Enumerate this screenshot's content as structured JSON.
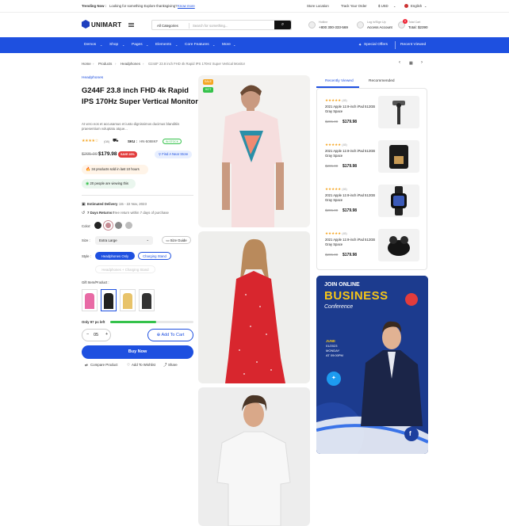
{
  "topbar": {
    "trending_prefix": "Trending Now :",
    "trending_text": "Looking for something Explore thanksgiving?",
    "trending_link": "Know more",
    "store_location": "Store Location",
    "track_order": "Track Your Order",
    "currency": "$ USD",
    "language": "English"
  },
  "header": {
    "logo": "UNIMART",
    "search_category": "All Categories",
    "search_placeholder": "Search for something...",
    "hotline_label": "Hotline",
    "hotline_number": "+800 300-333-569",
    "account_label": "Log in/Sign Up",
    "account_value": "Access Account",
    "cart_label": "Total Cart",
    "cart_total": "Total: $2390",
    "cart_count": "0"
  },
  "nav": {
    "items": [
      "Demos",
      "Shop",
      "Pages",
      "Elements",
      "Core Features",
      "More"
    ],
    "special_offers": "Special Offers",
    "recent_viewed": "Recent Viewed"
  },
  "breadcrumb": [
    "Home",
    "Products",
    "Headphones",
    "G244F 23.8 inch FHD 4k Rapid IPS 170Hz Super Vertical Monitor"
  ],
  "product": {
    "brand": "Headphones",
    "title": "G244F 23.8 inch FHD 4k Rapid IPS 170Hz Super Vertical Monitor",
    "description": "At vero eos et accusamus et iusto dignissimos ducimus blanditiis praesentium voluptatu atque...",
    "rating_count": "(08)",
    "sku_label": "SKU :",
    "sku_value": "HN-5088KF",
    "stock_badge": "IN STOCK",
    "old_price": "$295.00",
    "new_price": "$179.98",
    "discount_badge": "SAVE 20%",
    "find_store": "Find A Near Store",
    "sold_notice": "34 products sold in last 10 hours",
    "viewing_notice": "20 people are viewing this",
    "estimated_delivery_label": "Estimated Delivery :",
    "estimated_delivery_value": "15 - 22 Nov, 2023",
    "returns_label": "7 Days Returns :",
    "returns_value": "Free return within 7 days of purchase",
    "color_label": "Color:",
    "colors": [
      "#222222",
      "#c58a92",
      "#8a8a8a",
      "#bdbdbd"
    ],
    "size_label": "Size :",
    "size_value": "Extra Large",
    "size_guide": "Size Guide",
    "style_label": "Style :",
    "style_options": [
      "Headphones Only",
      "Charging Stand",
      "Headphones + Charging Stand"
    ],
    "gift_label": "Gift Item/Product :",
    "stock_left": "Only 97 pc left",
    "stock_progress": 0.55,
    "quantity": "05",
    "add_to_cart": "Add To Cart",
    "buy_now": "Buy Now",
    "compare": "Compare Product",
    "wishlist": "Add To Wishlist",
    "share": "Share"
  },
  "gallery": {
    "badge_sale": "SALE",
    "badge_hot": "HOT"
  },
  "sidebar": {
    "tabs": [
      "Recently Viewed",
      "Recommended"
    ],
    "items": [
      {
        "name": "2021 Apple 12.9-inch iPad 512GB Gray Space",
        "count": "(45)",
        "old_price": "$295.00",
        "new_price": "$179.98",
        "icon": "camera-gimbal-icon"
      },
      {
        "name": "2021 Apple 12.9-inch iPad 512GB Gray Space",
        "count": "(45)",
        "old_price": "$295.00",
        "new_price": "$179.98",
        "icon": "coffee-machine-icon"
      },
      {
        "name": "2021 Apple 12.9-inch iPad 512GB Gray Space",
        "count": "(45)",
        "old_price": "$295.00",
        "new_price": "$179.98",
        "icon": "smartwatch-icon"
      },
      {
        "name": "2021 Apple 12.9-inch iPad 512GB Gray Space",
        "count": "(45)",
        "old_price": "$295.00",
        "new_price": "$179.98",
        "icon": "earbuds-icon"
      }
    ],
    "banner": {
      "line1": "JOIN ONLINE",
      "line2": "BUSINESS",
      "line3": "Conference",
      "date1": "JUNE",
      "date2": "01/2023",
      "date3": "MONDAY",
      "date4": "AT 09:00PM"
    }
  },
  "colors": {
    "accent": "#1e50e0",
    "sale": "#e23c3c",
    "hot": "#35c24b",
    "star": "#f5a623"
  }
}
